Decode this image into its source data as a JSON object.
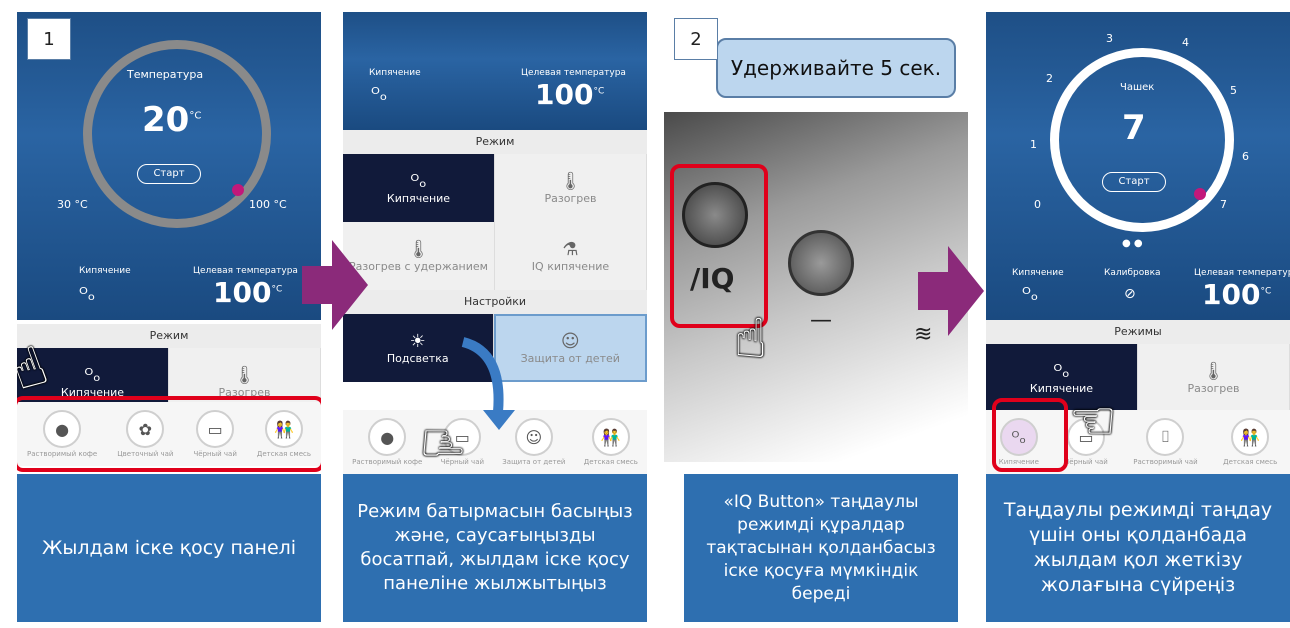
{
  "panel1": {
    "badge": "1",
    "temp_label": "Температура",
    "temp_value": "20",
    "temp_unit": "°C",
    "start_button": "Старт",
    "min_label": "30 °C",
    "max_label": "100 °C",
    "boil_label": "Кипячение",
    "target_label": "Целевая температура",
    "target_value": "100",
    "target_unit": "°C",
    "mode_title": "Режим",
    "mode_items": [
      "Кипячение",
      "Разогрев"
    ],
    "quick_items": [
      "Растворимый кофе",
      "Цветочный чай",
      "Чёрный чай",
      "Детская смесь"
    ],
    "caption": "Жылдам іске қосу панелі"
  },
  "panel2": {
    "boil_label": "Кипячение",
    "target_label": "Целевая температура",
    "target_value": "100",
    "target_unit": "°C",
    "mode_title": "Режим",
    "modes": [
      "Кипячение",
      "Разогрев",
      "Разогрев с удержанием",
      "IQ кипячение"
    ],
    "settings_title": "Настройки",
    "settings": [
      "Подсветка",
      "Защита от детей"
    ],
    "quick_items": [
      "Растворимый кофе",
      "Чёрный чай",
      "Защита от детей",
      "Детская смесь"
    ],
    "caption": "Режим батырмасын басыңыз және, саусағыңызды босатпай, жылдам іске қосу панеліне жылжытыңыз"
  },
  "panel3": {
    "badge": "2",
    "hold_text": "Удерживайте 5 сек.",
    "iq_label": "/IQ",
    "caption": "«IQ Button» таңдаулы режимді құралдар тақтасынан қолданбасыз іске қосуға мүмкіндік береді"
  },
  "panel4": {
    "dial_numbers": [
      "0",
      "1",
      "2",
      "3",
      "4",
      "5",
      "6",
      "7"
    ],
    "cups_label": "Чашек",
    "cups_value": "7",
    "start_button": "Старт",
    "boil_label": "Кипячение",
    "calib_label": "Калибровка",
    "target_label": "Целевая температура",
    "target_value": "100",
    "target_unit": "°C",
    "modes_title": "Режимы",
    "mode_items": [
      "Кипячение",
      "Разогрев"
    ],
    "quick_items": [
      "Кипячение",
      "Чёрный чай",
      "Растворимый чай",
      "Детская смесь"
    ],
    "caption": "Таңдаулы режимді таңдау үшін оны қолданбада жылдам қол жеткізу жолағына сүйреңіз"
  },
  "colors": {
    "accent_red": "#e0001b",
    "arrow_purple": "#8b2a7a",
    "caption_blue": "#2e6fb0",
    "dark_mode": "#111a3a"
  }
}
